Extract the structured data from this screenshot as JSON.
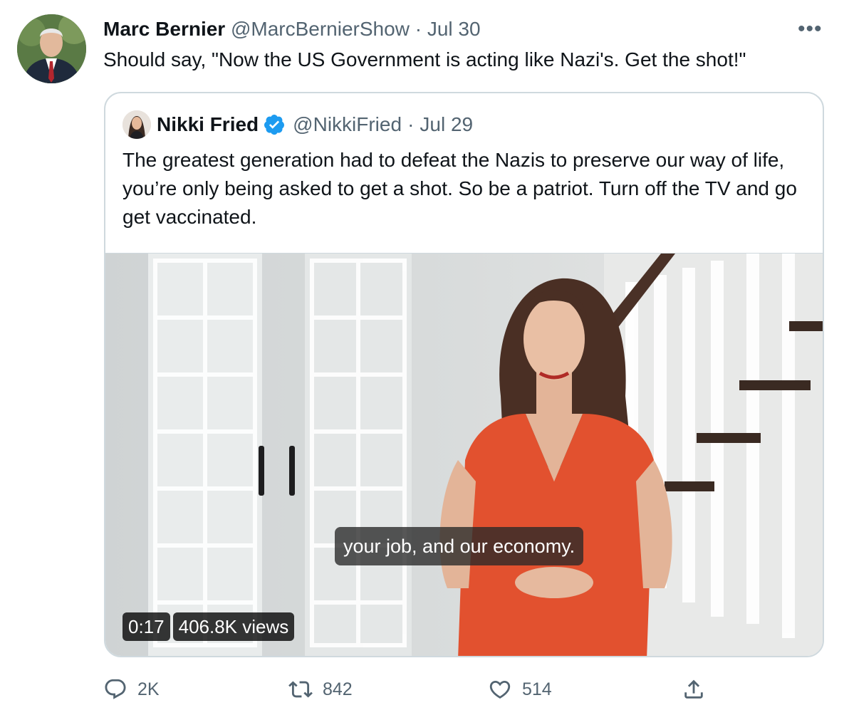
{
  "tweet": {
    "author_name": "Marc Bernier",
    "author_handle": "@MarcBernierShow",
    "separator": "·",
    "date": "Jul 30",
    "more_label": "•••",
    "text": "Should say, \"Now the US Government is acting like Nazi's. Get the shot!\""
  },
  "quoted": {
    "author_name": "Nikki Fried",
    "author_handle": "@NikkiFried",
    "separator": "·",
    "date": "Jul 29",
    "verified": true,
    "text": "The greatest generation had to defeat the Nazis to preserve our way of life, you’re only being asked to get a shot. So be a patriot. Turn off the TV and go get vaccinated.",
    "video": {
      "caption": "your job, and our economy.",
      "duration": "0:17",
      "views": "406.8K views"
    }
  },
  "actions": {
    "reply_count": "2K",
    "retweet_count": "842",
    "like_count": "514"
  },
  "colors": {
    "text_primary": "#0f1419",
    "text_muted": "#536471",
    "border": "#cfd9de",
    "verified_blue": "#1d9bf0",
    "dress_red": "#e2512f"
  },
  "icons": [
    "more-icon",
    "verified-badge-icon",
    "reply-icon",
    "retweet-icon",
    "like-icon",
    "share-icon"
  ]
}
